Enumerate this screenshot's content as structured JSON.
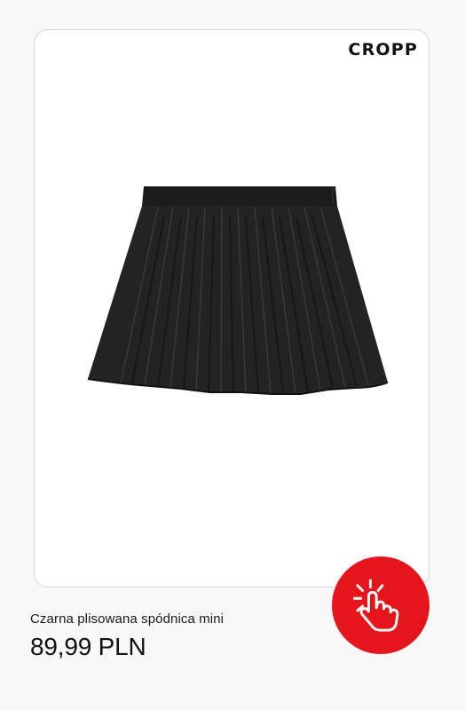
{
  "brand": {
    "logo_text": "CROPP"
  },
  "product": {
    "image_icon": "pleated-skirt-image",
    "name": "Czarna plisowana spódnica mini",
    "price": "89,99 PLN"
  },
  "cta": {
    "icon": "tap-hand-icon",
    "color": "#e5161b"
  },
  "colors": {
    "background": "#f9f8f8",
    "card": "#ffffff",
    "card_border": "#d9d6d6",
    "text": "#111111"
  }
}
